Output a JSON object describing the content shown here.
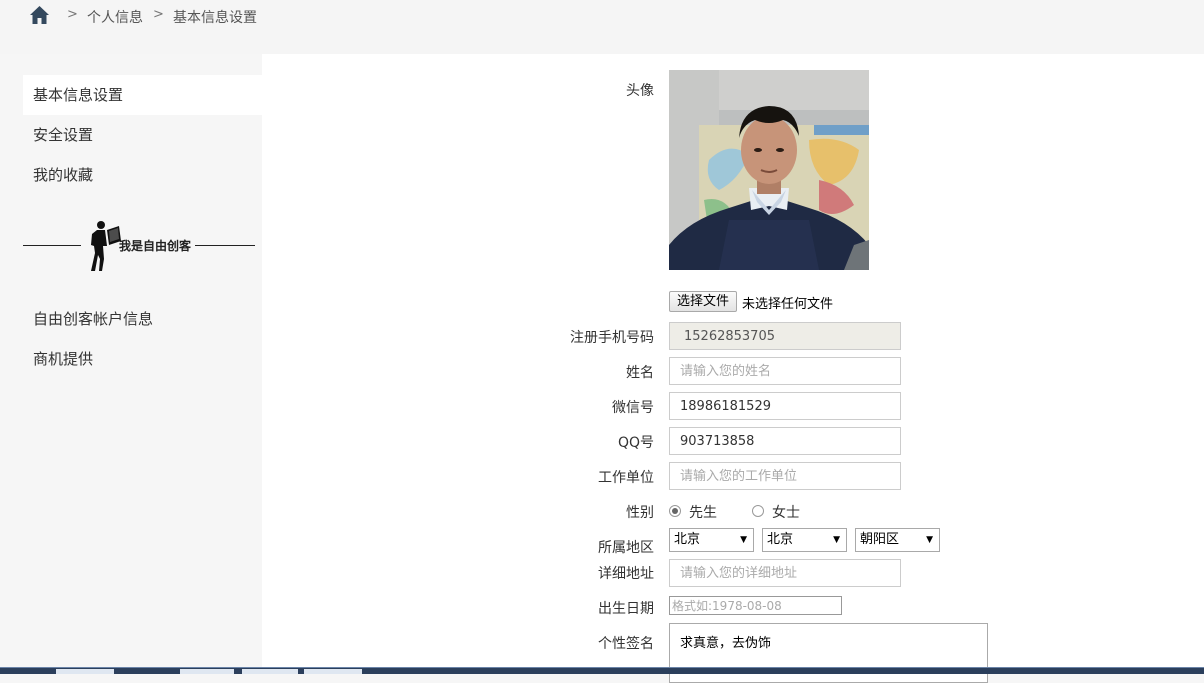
{
  "breadcrumb": {
    "home_icon": "home-icon",
    "separator": ">",
    "items": [
      "个人信息",
      "基本信息设置"
    ]
  },
  "sidebar": {
    "items": [
      {
        "label": "基本信息设置",
        "active": true
      },
      {
        "label": "安全设置",
        "active": false
      },
      {
        "label": "我的收藏",
        "active": false
      }
    ],
    "divider_text": "我是自由创客",
    "items2": [
      {
        "label": "自由创客帐户信息"
      },
      {
        "label": "商机提供"
      }
    ]
  },
  "form": {
    "avatar_label": "头像",
    "file_button": "选择文件",
    "file_status": "未选择任何文件",
    "phone_label": "注册手机号码",
    "phone_value": "15262853705",
    "name_label": "姓名",
    "name_placeholder": "请输入您的姓名",
    "wechat_label": "微信号",
    "wechat_value": "18986181529",
    "qq_label": "QQ号",
    "qq_value": "903713858",
    "work_label": "工作单位",
    "work_placeholder": "请输入您的工作单位",
    "gender_label": "性别",
    "gender_options": [
      {
        "label": "先生",
        "checked": true
      },
      {
        "label": "女士",
        "checked": false
      }
    ],
    "region_label": "所属地区",
    "region_selects": [
      "北京",
      "北京",
      "朝阳区"
    ],
    "address_label": "详细地址",
    "address_placeholder": "请输入您的详细地址",
    "birth_label": "出生日期",
    "birth_placeholder": "格式如:1978-08-08",
    "signature_label": "个性签名",
    "signature_value": "求真意，去伪饰"
  },
  "colors": {
    "page_bg": "#f6f6f6",
    "panel_bg": "#ffffff",
    "readonly_bg": "#eeede7",
    "text": "#333333"
  }
}
